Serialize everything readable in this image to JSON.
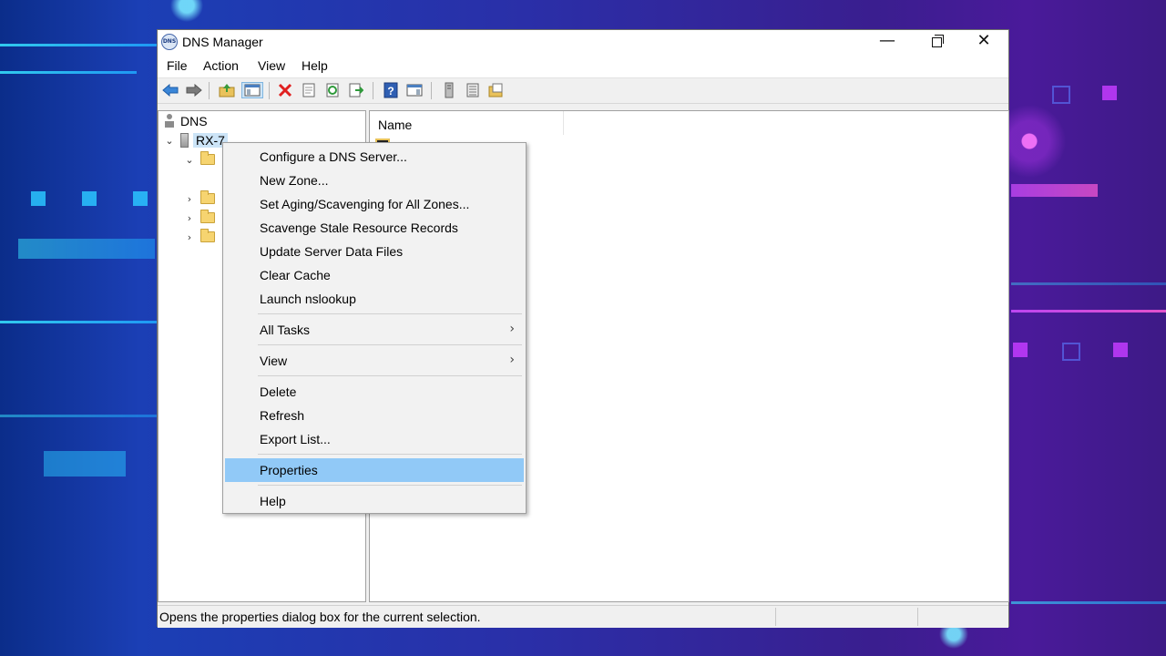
{
  "window": {
    "title": "DNS Manager",
    "icon_text": "DNS",
    "controls": {
      "minimize": "—",
      "close": "✕"
    }
  },
  "menubar": {
    "items": [
      "File",
      "Action",
      "View",
      "Help"
    ]
  },
  "toolbar": {
    "buttons": [
      "back-icon",
      "forward-icon",
      "up-folder-icon",
      "show-hide-console-tree-icon",
      "delete-icon",
      "properties-icon",
      "refresh-icon",
      "export-list-icon",
      "help-icon",
      "show-action-pane-icon",
      "server-icon",
      "list-view-icon",
      "new-zone-icon"
    ]
  },
  "tree": {
    "root": "DNS",
    "server": "RX-7",
    "chevrons": {
      "expanded": "⌄",
      "collapsed": "›"
    }
  },
  "list": {
    "column_name": "Name"
  },
  "context_menu": {
    "items": [
      "Configure a DNS Server...",
      "New Zone...",
      "Set Aging/Scavenging for All Zones...",
      "Scavenge Stale Resource Records",
      "Update Server Data Files",
      "Clear Cache",
      "Launch nslookup",
      "All Tasks",
      "View",
      "Delete",
      "Refresh",
      "Export List...",
      "Properties",
      "Help"
    ],
    "submenu_arrow": "›",
    "highlighted": "Properties"
  },
  "status": {
    "text": "Opens the properties dialog box for the current selection."
  },
  "colors": {
    "highlight": "#91c9f7",
    "selection": "#cce4f7"
  }
}
